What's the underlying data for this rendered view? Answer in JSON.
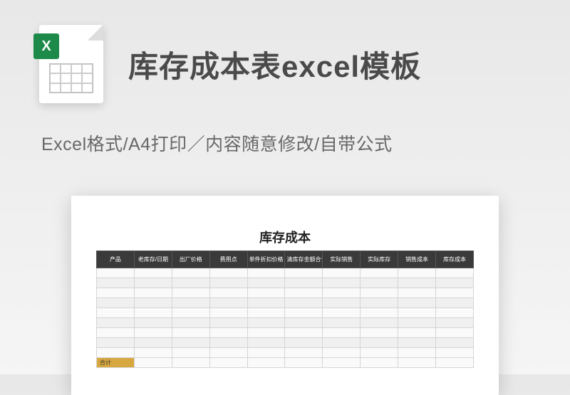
{
  "header": {
    "icon_label": "X",
    "title": "库存成本表excel模板",
    "subtitle": "Excel格式/A4打印／内容随意修改/自带公式"
  },
  "chart_data": {
    "type": "table",
    "title": "库存成本",
    "columns": [
      "产品",
      "老库存/日期",
      "出厂价格",
      "费用点",
      "单件折扣价格",
      "清库存金额合计",
      "实际销售",
      "实际库存",
      "销售成本",
      "库存成本"
    ],
    "rows": [
      [
        "",
        "",
        "",
        "",
        "",
        "",
        "",
        "",
        "",
        ""
      ],
      [
        "",
        "",
        "",
        "",
        "",
        "",
        "",
        "",
        "",
        ""
      ],
      [
        "",
        "",
        "",
        "",
        "",
        "",
        "",
        "",
        "",
        ""
      ],
      [
        "",
        "",
        "",
        "",
        "",
        "",
        "",
        "",
        "",
        ""
      ],
      [
        "",
        "",
        "",
        "",
        "",
        "",
        "",
        "",
        "",
        ""
      ],
      [
        "",
        "",
        "",
        "",
        "",
        "",
        "",
        "",
        "",
        ""
      ],
      [
        "",
        "",
        "",
        "",
        "",
        "",
        "",
        "",
        "",
        ""
      ],
      [
        "",
        "",
        "",
        "",
        "",
        "",
        "",
        "",
        "",
        ""
      ],
      [
        "",
        "",
        "",
        "",
        "",
        "",
        "",
        "",
        "",
        ""
      ]
    ],
    "footer_label": "合计"
  }
}
